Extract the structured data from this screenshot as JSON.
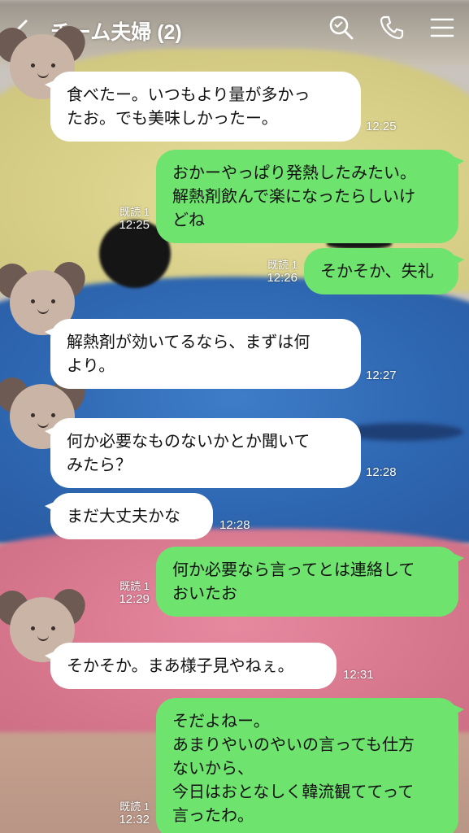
{
  "header": {
    "back_icon": "chevron-left-icon",
    "title": "チーム夫婦 (2)",
    "icons": [
      "search-icon",
      "phone-icon",
      "menu-icon"
    ]
  },
  "colors": {
    "incoming_bubble": "#ffffff",
    "outgoing_bubble": "#6ee36e",
    "meta_text": "#ffffff"
  },
  "messages": [
    {
      "dir": "in",
      "text": "食べたー。いつもより量が多かったお。でも美味しかったー。",
      "time": "12:25",
      "read": ""
    },
    {
      "dir": "out",
      "text": "おかーやっぱり発熱したみたい。解熱剤飲んで楽になったらしいけどね",
      "time": "12:25",
      "read": "既読 1"
    },
    {
      "dir": "out",
      "text": "そかそか、失礼",
      "time": "12:26",
      "read": "既読 1"
    },
    {
      "dir": "in",
      "text": "解熱剤が効いてるなら、まずは何より。",
      "time": "12:27",
      "read": ""
    },
    {
      "dir": "in",
      "text": "何か必要なものないかとか聞いてみたら？",
      "time": "12:28",
      "read": ""
    },
    {
      "dir": "in",
      "text": "まだ大丈夫かな",
      "time": "12:28",
      "read": ""
    },
    {
      "dir": "out",
      "text": "何か必要なら言ってとは連絡しておいたお",
      "time": "12:29",
      "read": "既読 1"
    },
    {
      "dir": "in",
      "text": "そかそか。まあ様子見やねぇ。",
      "time": "12:31",
      "read": ""
    },
    {
      "dir": "out",
      "text": "そだよねー。あまりやいのやいの言っても仕方ないから、今日はおとなしく韓流観ててって言ったわ。",
      "time": "12:32",
      "read": "既読 1"
    }
  ],
  "lines": {
    "m0": "食べたー。いつもより量が多かっ\nたお。でも美味しかったー。",
    "m1": "おかーやっぱり発熱したみたい。\n解熱剤飲んで楽になったらしいけ\nどね",
    "m2": "そかそか、失礼",
    "m3": "解熱剤が効いてるなら、まずは何\nより。",
    "m4": "何か必要なものないかとか聞いて\nみたら？",
    "m5": "まだ大丈夫かな",
    "m6": "何か必要なら言ってとは連絡して\nおいたお",
    "m7": "そかそか。まあ様子見やねぇ。",
    "m8": "そだよねー。\nあまりやいのやいの言っても仕方\nないから、\n今日はおとなしく韓流観ててって\n言ったわ。"
  }
}
